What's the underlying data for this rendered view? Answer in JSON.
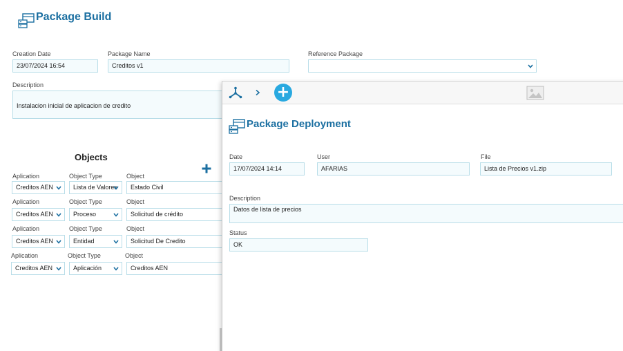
{
  "build": {
    "title": "Package Build",
    "creation_date_label": "Creation Date",
    "creation_date_value": "23/07/2024 16:54",
    "package_name_label": "Package Name",
    "package_name_value": "Creditos v1",
    "reference_package_label": "Reference Package",
    "reference_package_value": "",
    "description_label": "Description",
    "description_value": "Instalacion inicial de aplicacion de credito",
    "objects_title": "Objects",
    "columns": [
      "Aplication",
      "Object Type",
      "Object"
    ],
    "rows": [
      {
        "aplication": "Creditos AEN",
        "object_type": "Lista de Valores",
        "object": "Estado Civil"
      },
      {
        "aplication": "Creditos AEN",
        "object_type": "Proceso",
        "object": "Solicitud de crédito"
      },
      {
        "aplication": "Creditos AEN",
        "object_type": "Entidad",
        "object": "Solicitud De Credito"
      },
      {
        "aplication": "Creditos AEN",
        "object_type": "Aplicación",
        "object": "Creditos AEN"
      }
    ]
  },
  "deploy": {
    "title": "Package Deployment",
    "date_label": "Date",
    "date_value": "17/07/2024 14:14",
    "user_label": "User",
    "user_value": "AFARIAS",
    "file_label": "File",
    "file_value": "Lista de Precios v1.zip",
    "description_label": "Description",
    "description_value": "Datos de lista de precios",
    "status_label": "Status",
    "status_value": "OK",
    "toolbar": {
      "hierarchy_icon": "hierarchy-icon",
      "chevron_icon": "chevron-right-icon",
      "add_button": "+",
      "image_icon": "image-icon"
    }
  },
  "colors": {
    "title_blue": "#1b6fa1",
    "accent_cyan": "#29a9e0",
    "field_border": "#b8dde8",
    "field_bg": "#f4fbfd"
  }
}
